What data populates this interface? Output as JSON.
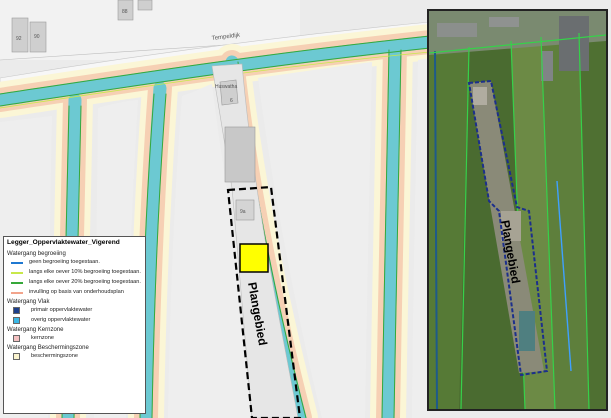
{
  "map": {
    "street_name": "Tempeldijk",
    "building_labels": [
      "92",
      "90",
      "88",
      "Huswatha",
      "6",
      "9a"
    ],
    "plan_area_label": "Plangebied"
  },
  "inset": {
    "plan_area_label": "Plangebied"
  },
  "legend": {
    "title": "Legger_Oppervlaktewater_Vigerend",
    "groups": [
      {
        "title": "Watergang begroeiing",
        "items": [
          {
            "label": "geen begroeiing toegestaan.",
            "symbol": "line",
            "color": "#1f78d1"
          },
          {
            "label": "langs elke oever 10% begroeiing toegestaan.",
            "symbol": "line",
            "color": "#c8e84a"
          },
          {
            "label": "langs elke oever 20% begroeiing toegestaan.",
            "symbol": "line",
            "color": "#36a83a"
          },
          {
            "label": "invulling op basis van onderhoudsplan",
            "symbol": "line",
            "color": "#f2a48c"
          }
        ]
      },
      {
        "title": "Watergang Vlak",
        "items": [
          {
            "label": "primair oppervlaktewater",
            "symbol": "box",
            "color": "#1c3f8c"
          },
          {
            "label": "overig oppervlaktewater",
            "symbol": "box",
            "color": "#39b7e6"
          }
        ]
      },
      {
        "title": "Watergang Kernzone",
        "items": [
          {
            "label": "kernzone",
            "symbol": "box",
            "color": "#f4c1c1"
          }
        ]
      },
      {
        "title": "Watergang Beschermingszone",
        "items": [
          {
            "label": "beschermingszone",
            "symbol": "box",
            "color": "#fbf4cf"
          }
        ]
      }
    ]
  },
  "colors": {
    "water": "#6cc9d2",
    "kernzone": "#f6d0b4",
    "beschermingszone": "#fbf6d6",
    "land": "#eeeeee",
    "plan_marker": "#ffff00"
  }
}
